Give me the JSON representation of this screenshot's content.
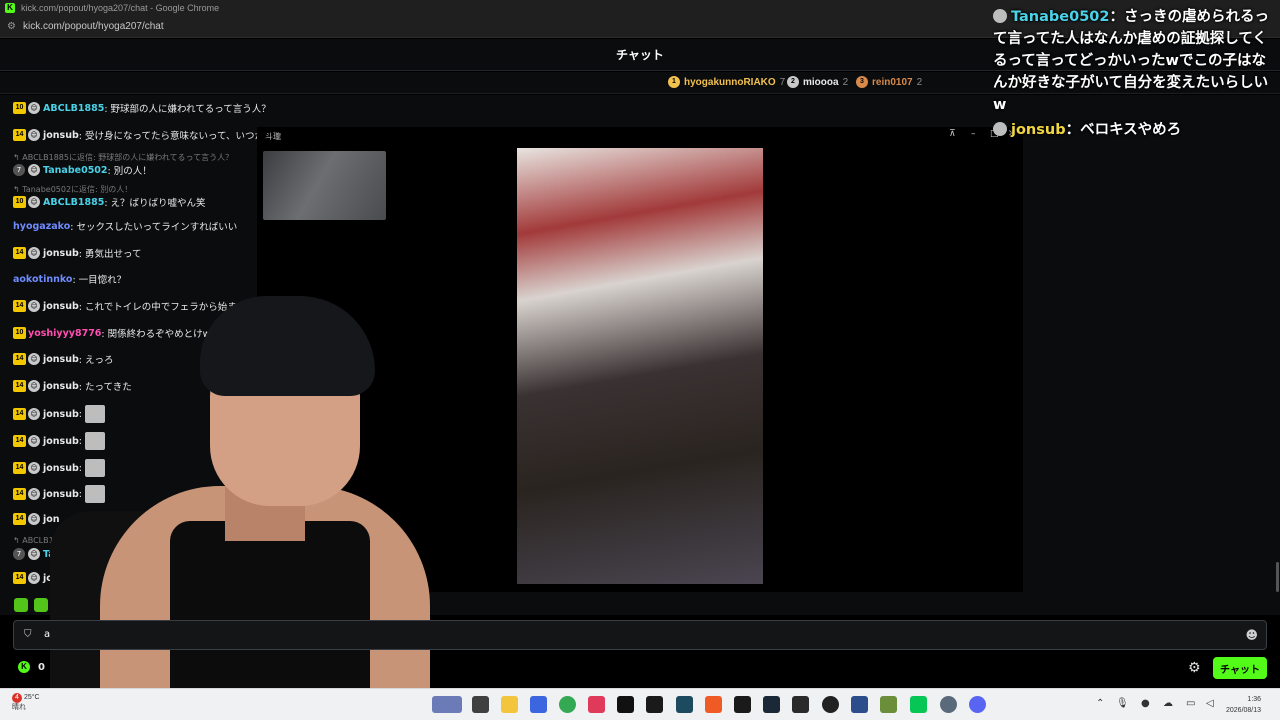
{
  "browser": {
    "window_title": "kick.com/popout/hyoga207/chat - Google Chrome",
    "url": "kick.com/popout/hyoga207/chat"
  },
  "chat": {
    "header": "チャット",
    "leaderboard": [
      {
        "rank": "1",
        "name": "hyogakunnoRIAKO",
        "count": "7",
        "color": "#f2c14e"
      },
      {
        "rank": "2",
        "name": "mioooa",
        "count": "2",
        "color": "#c9c9c9"
      },
      {
        "rank": "3",
        "name": "rein0107",
        "count": "2",
        "color": "#d98a4a"
      }
    ],
    "messages": [
      {
        "sub": "10",
        "user": "ABCLB1885",
        "text": ": 野球部の人に嫌われてるって言う人？"
      },
      {
        "sub": "14",
        "user": "jonsub",
        "text": ": 受け身になってたら意味ないって、いつか"
      },
      {
        "reply": "ABCLB1885に返信: 野球部の人に嫌われてるって言う人？"
      },
      {
        "sub": "7",
        "user": "Tanabe0502",
        "text": ": 別の人！"
      },
      {
        "reply": "Tanabe0502に返信: 別の人！"
      },
      {
        "sub": "10",
        "user": "ABCLB1885",
        "text": ": え？ばりばり嘘やん笑"
      },
      {
        "user": "hyogazako",
        "text": ": セックスしたいってラインすればいい"
      },
      {
        "sub": "14",
        "user": "jonsub",
        "text": ": 勇気出せって"
      },
      {
        "user": "aokotinnko",
        "text": ": 一目惚れ？"
      },
      {
        "sub": "14",
        "user": "jonsub",
        "text": ": これでトイレの中でフェラから始まると、"
      },
      {
        "sub": "10",
        "user": "yoshiyyy8776",
        "text": ": 関係終わるぞやめとけwww"
      },
      {
        "sub": "14",
        "user": "jonsub",
        "text": ": えっろ"
      },
      {
        "sub": "14",
        "user": "jonsub",
        "text": ": たってきた"
      },
      {
        "sub": "14",
        "user": "jonsub",
        "text": ":"
      },
      {
        "sub": "14",
        "user": "jonsub",
        "text": ":"
      },
      {
        "sub": "14",
        "user": "jonsub",
        "text": ":"
      },
      {
        "sub": "14",
        "user": "jonsub",
        "text": ":"
      },
      {
        "sub": "14",
        "user": "jon"
      },
      {
        "reply": "ABCLB1"
      },
      {
        "sub": "7",
        "user": "Ta"
      },
      {
        "sub": "14",
        "user": "jo"
      }
    ],
    "input_value": "a",
    "points": "0",
    "send_label": "チャット"
  },
  "pip": {
    "title": "斗瓏",
    "controls": [
      "pin-icon",
      "minimize-icon",
      "maximize-icon",
      "close-icon"
    ]
  },
  "overlay_chat": [
    {
      "user": "Tanabe0502",
      "text": "：さっきの虐められるって言ってた人はなんか虐めの証拠探してくるって言ってどっかいったwでこの子はなんか好きな子がいて自分を変えたいらしいw"
    },
    {
      "user": "jonsub",
      "text": "：ベロキスやめろ"
    }
  ],
  "taskbar": {
    "weather_temp": "25°C",
    "weather_desc": "晴れ",
    "weather_badge": "4",
    "time": "1:36",
    "date": "2026/08/13"
  },
  "colors": {
    "kick_green": "#53fc18",
    "sub_badge": "#f2c700",
    "cyan_user": "#4ad2e8",
    "pink_user": "#ff4fb0",
    "blue_user": "#6f8cff"
  }
}
